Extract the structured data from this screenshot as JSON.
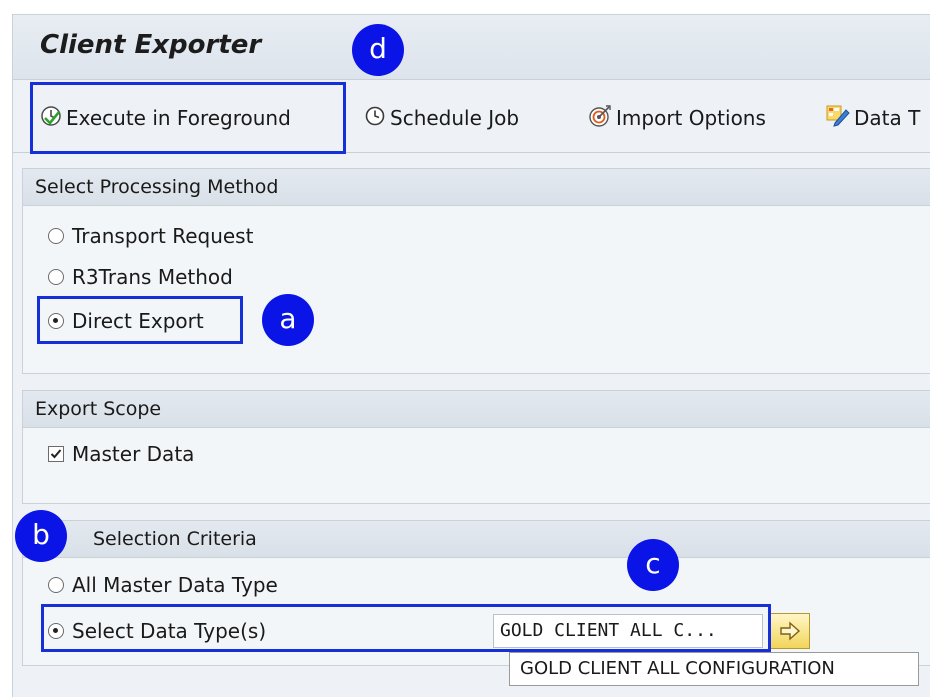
{
  "app": {
    "title": "Client Exporter"
  },
  "toolbar": {
    "execute_label": "Execute in Foreground",
    "schedule_label": "Schedule Job",
    "import_label": "Import Options",
    "data_label": "Data T"
  },
  "processing": {
    "header": "Select Processing Method",
    "options": [
      "Transport Request",
      "R3Trans Method",
      "Direct Export"
    ],
    "selected": "Direct Export"
  },
  "scope": {
    "header": "Export Scope",
    "master_data_label": "Master Data",
    "master_data_checked": true
  },
  "criteria": {
    "header": "Selection Criteria",
    "options": [
      "All Master Data Type",
      "Select Data Type(s)"
    ],
    "selected": "Select Data Type(s)",
    "field_value": "GOLD CLIENT ALL C...",
    "tooltip": "GOLD CLIENT ALL CONFIGURATION"
  },
  "callouts": {
    "a": "a",
    "b": "b",
    "c": "c",
    "d": "d"
  },
  "colors": {
    "callout": "#0b14e6",
    "highlight": "#1530d8",
    "header_bg": "#dde4ec"
  }
}
